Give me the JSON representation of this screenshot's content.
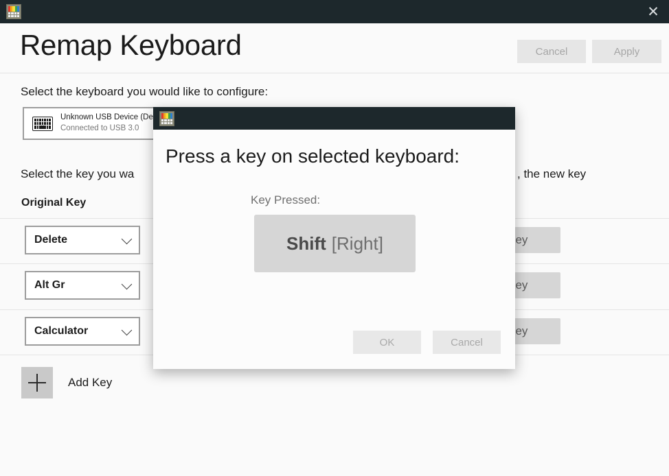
{
  "window": {
    "app_icon": "keyboard-manager-icon",
    "close_label": "✕",
    "title": "Remap Keyboard",
    "cancel_label": "Cancel",
    "apply_label": "Apply"
  },
  "icon_colors": {
    "stripe1": "#e23b2e",
    "stripe2": "#f2a41c",
    "stripe3": "#f6e03a",
    "stripe4": "#3fa34d",
    "stripe5": "#2f7fd1",
    "titlebar": "#1d282c",
    "accent_button": "#d6d6d6"
  },
  "body": {
    "select_keyboard_label": "Select the keyboard you would like to configure:",
    "device": {
      "icon": "keyboard-icon",
      "name": "Unknown USB Device (Device Descriptor Request Failed)",
      "status": "Connected to USB 3.0"
    },
    "select_key_sentence": "Select the key you want to remap, and then press the key you want it to become, the new key",
    "select_key_sentence_visible_left": "Select the key you wa",
    "select_key_sentence_visible_right": ", the new key",
    "column_header_original": "Original Key",
    "rows": [
      {
        "original_key": "Delete",
        "new_key_button": "Type Key",
        "new_key_button_visible": "e Key"
      },
      {
        "original_key": "Alt Gr",
        "new_key_button": "Type Key",
        "new_key_button_visible": "e Key"
      },
      {
        "original_key": "Calculator",
        "new_key_button": "Type Key",
        "new_key_button_visible": "e Key"
      }
    ],
    "add_key_label": "Add Key",
    "add_key_icon": "plus-icon"
  },
  "modal": {
    "app_icon": "keyboard-manager-icon",
    "title": "Press a key on selected keyboard:",
    "key_pressed_label": "Key Pressed:",
    "key_main": "Shift",
    "key_modifier": "[Right]",
    "ok_label": "OK",
    "cancel_label": "Cancel"
  }
}
